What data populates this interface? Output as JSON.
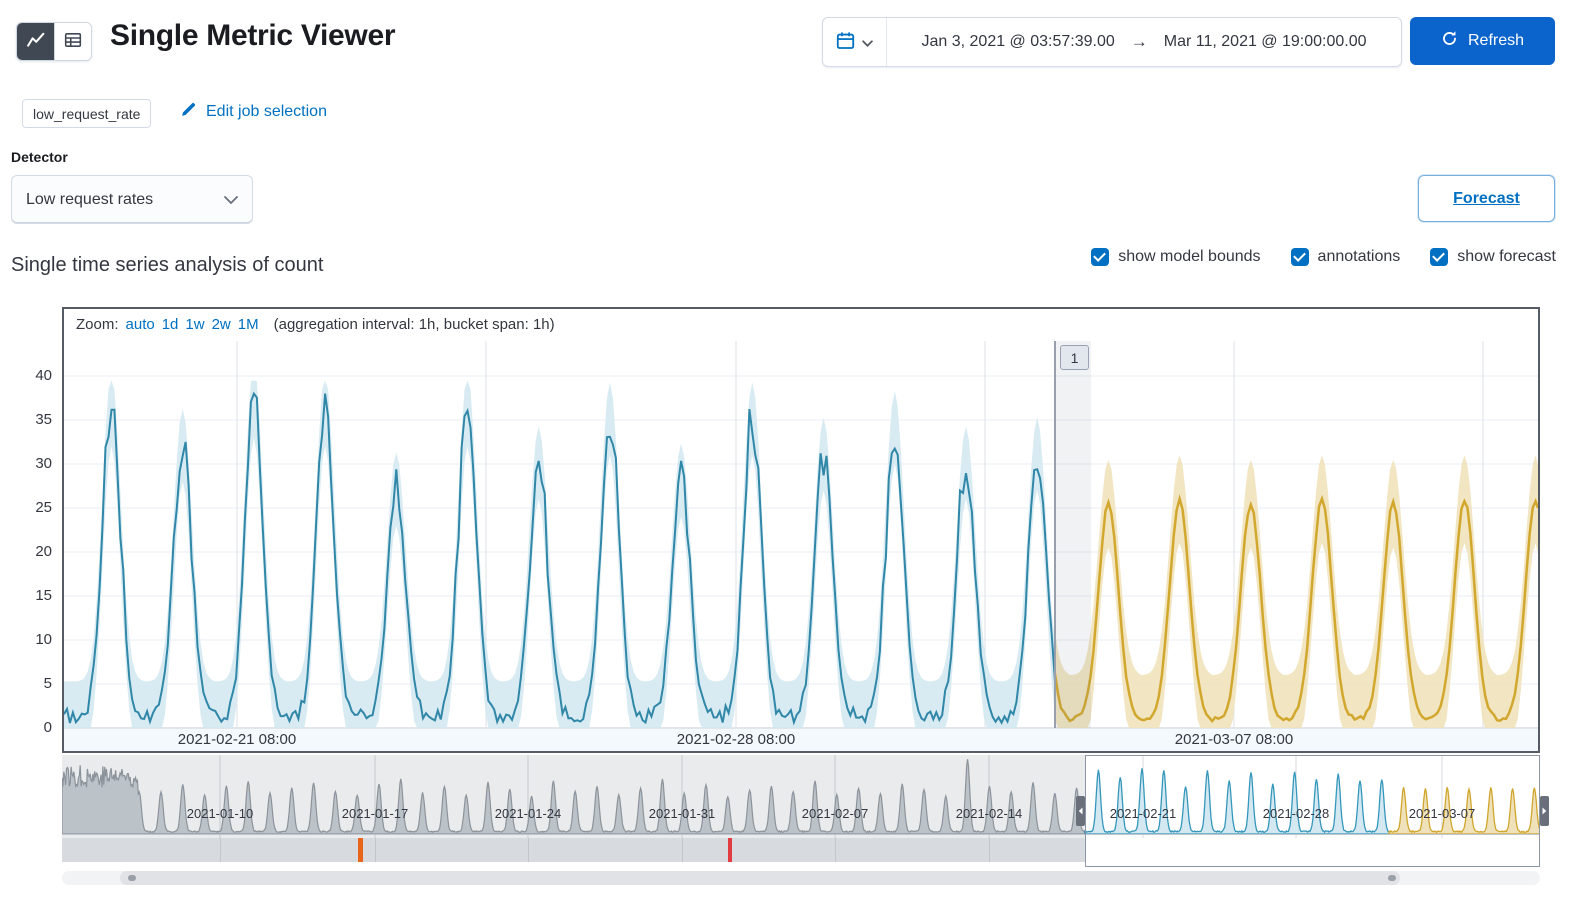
{
  "header": {
    "title": "Single Metric Viewer",
    "view_modes": [
      {
        "name": "chart",
        "selected": true
      },
      {
        "name": "table",
        "selected": false
      }
    ],
    "time_range": {
      "start": "Jan 3, 2021 @ 03:57:39.00",
      "separator": "→",
      "end": "Mar 11, 2021 @ 19:00:00.00"
    },
    "refresh_label": "Refresh"
  },
  "job_selection": {
    "badge": "low_request_rate",
    "edit_link": "Edit job selection"
  },
  "detector": {
    "label": "Detector",
    "selected_option": "Low request rates",
    "forecast_button": "Forecast"
  },
  "analysis": {
    "section_title": "Single time series analysis of count",
    "toggles": [
      {
        "label": "show model bounds",
        "checked": true
      },
      {
        "label": "annotations",
        "checked": true
      },
      {
        "label": "show forecast",
        "checked": true
      }
    ]
  },
  "focus_chart": {
    "zoom_label": "Zoom:",
    "zoom_options": [
      "auto",
      "1d",
      "1w",
      "2w",
      "1M"
    ],
    "interval_note": "(aggregation interval: 1h, bucket span: 1h)",
    "annotation_label": "1"
  },
  "chart_data": {
    "type": "line",
    "title": "Single time series analysis of count",
    "ylim": [
      0,
      43
    ],
    "y_ticks": [
      0,
      5,
      10,
      15,
      20,
      25,
      30,
      35,
      40
    ],
    "focus_x_ticks": [
      "2021-02-21 08:00",
      "2021-02-28 08:00",
      "2021-03-07 08:00"
    ],
    "series": [
      {
        "name": "actual",
        "color": "#3087a8",
        "band_color": "#d2e7f0",
        "daily_peaks": [
          35,
          31,
          36,
          35,
          26,
          35,
          29,
          34,
          27,
          34,
          30,
          33,
          29,
          30
        ]
      },
      {
        "name": "model bounds",
        "color": "#d2e7f0"
      },
      {
        "name": "forecast",
        "color": "#d2a72d",
        "band_color": "#efe2bb",
        "daily_peaks": [
          25,
          24.5,
          25,
          24.5,
          25,
          24.5,
          25,
          25
        ]
      }
    ],
    "context": {
      "x_ticks": [
        "2021-01-10",
        "2021-01-17",
        "2021-01-24",
        "2021-01-31",
        "2021-02-07",
        "2021-02-14",
        "2021-02-21",
        "2021-02-28",
        "2021-03-07"
      ],
      "daily_peaks": [
        23,
        27,
        21,
        26,
        29,
        22,
        25,
        28,
        23,
        21,
        27,
        30,
        22,
        26,
        21,
        28,
        24,
        20,
        29,
        23,
        26,
        21,
        25,
        30,
        22,
        27,
        20,
        24,
        26,
        23,
        29,
        21,
        25,
        22,
        27,
        24,
        20,
        41,
        26,
        23,
        28,
        22,
        25
      ],
      "annotation_markers": [
        {
          "color": "#e8651a"
        },
        {
          "color": "#e23b41"
        }
      ]
    },
    "colors": {
      "primary": "#0071c2",
      "refresh_button": "#0b64cc",
      "annotation_line": "#98a0ad"
    }
  }
}
